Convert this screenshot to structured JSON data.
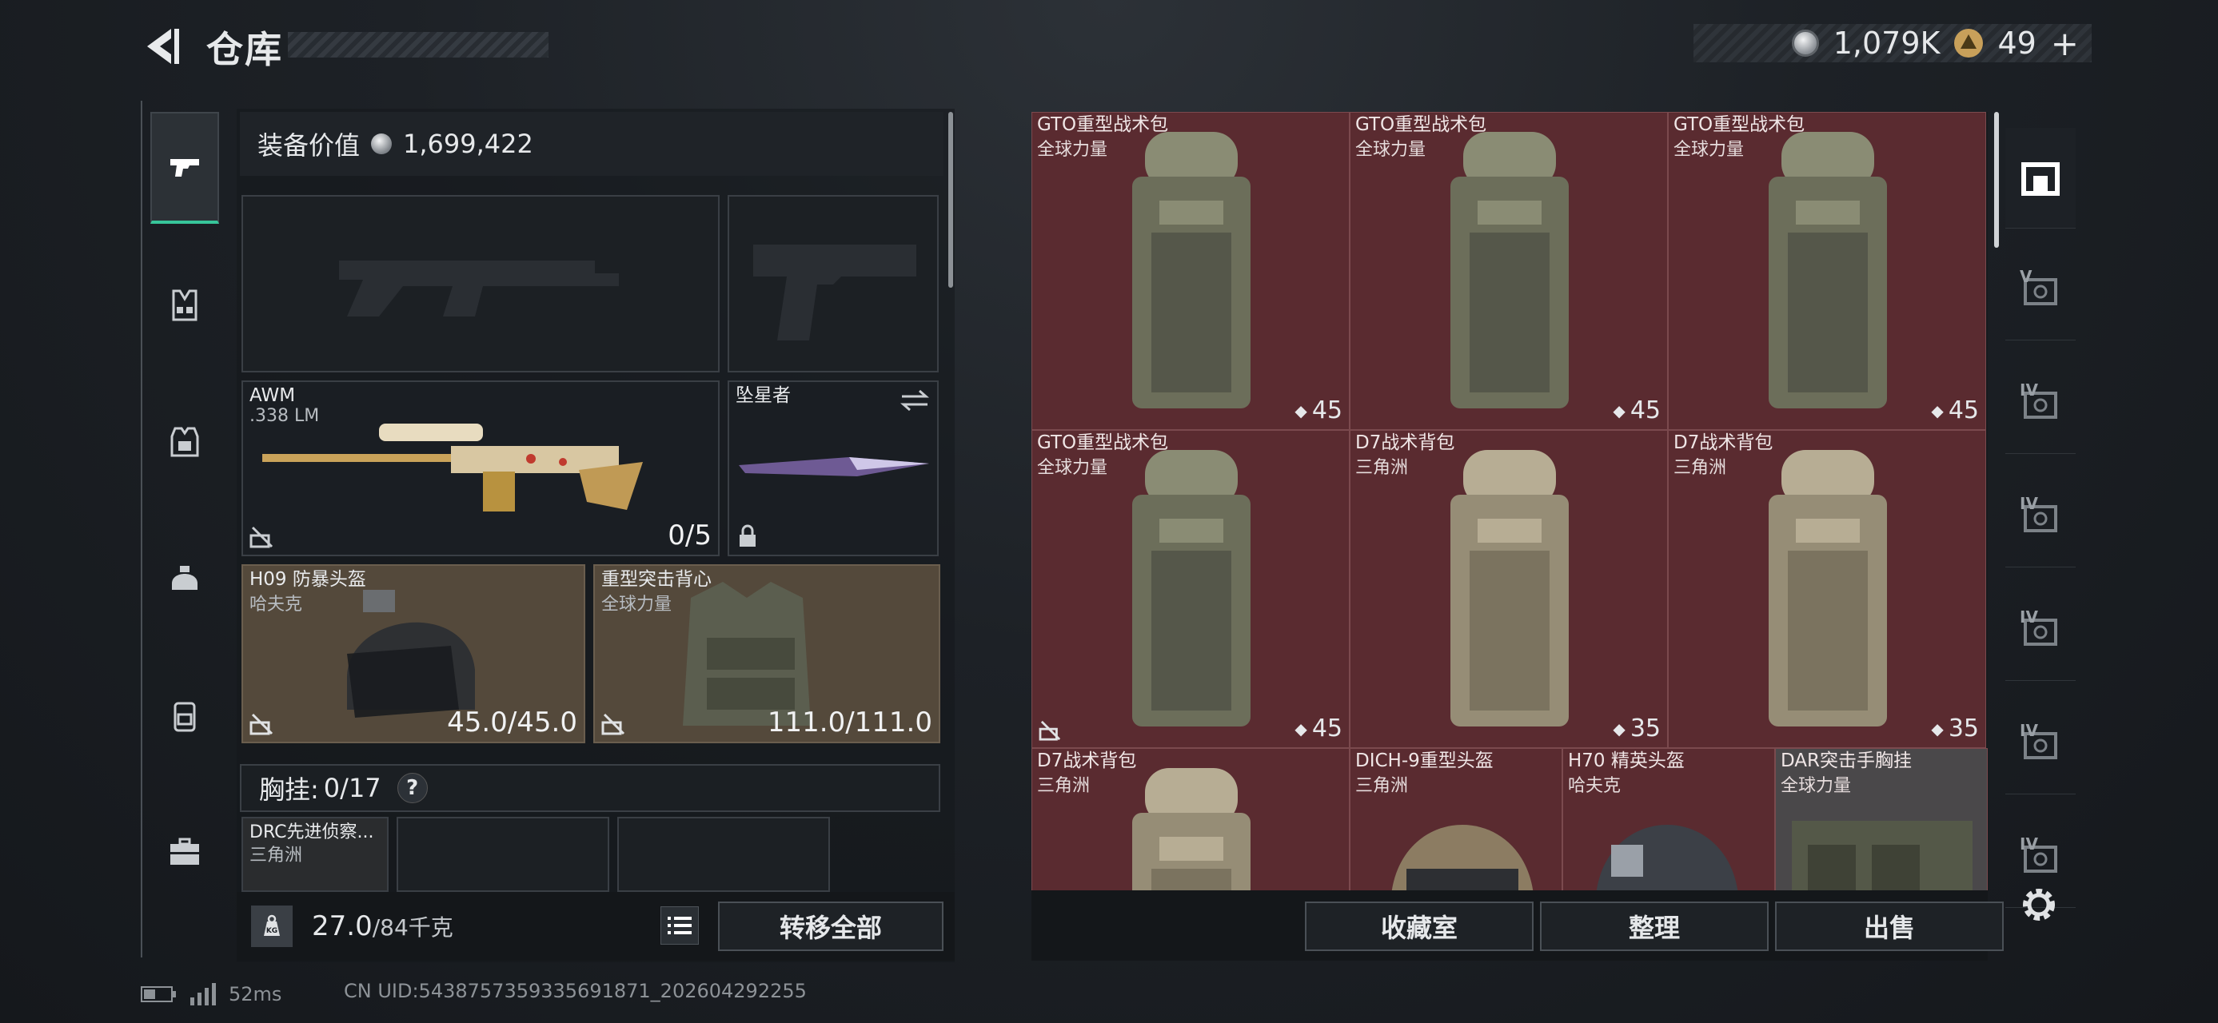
{
  "header": {
    "title": "仓库",
    "silver_amount": "1,079K",
    "gold_amount": "49",
    "gold_plus": "+"
  },
  "equipment": {
    "value_label": "装备价值",
    "value": "1,699,422",
    "primary_slot": {
      "name": "",
      "empty": true
    },
    "secondary_slot": {
      "name": "",
      "empty": true
    },
    "sniper": {
      "name": "AWM",
      "ammo_type": ".338 LM",
      "ammo_count": "0/5"
    },
    "melee": {
      "name": "坠星者"
    },
    "helmet": {
      "name": "H09 防暴头盔",
      "brand": "哈夫克",
      "durability": "45.0/45.0"
    },
    "armor": {
      "name": "重型突击背心",
      "brand": "全球力量",
      "durability": "111.0/111.0"
    },
    "chest_rig": {
      "label": "胸挂:",
      "count": "0/17",
      "help": "?"
    },
    "rig_items": [
      {
        "name": "DRC先进侦察...",
        "brand": "三角洲"
      }
    ],
    "weight": {
      "current": "27.0",
      "capacity": "/84千克",
      "kg_badge": "KG"
    },
    "transfer_all_label": "转移全部"
  },
  "storage": {
    "items": [
      {
        "name": "GTO重型战术包",
        "brand": "全球力量",
        "capacity": "45",
        "color": "olive"
      },
      {
        "name": "GTO重型战术包",
        "brand": "全球力量",
        "capacity": "45",
        "color": "olive"
      },
      {
        "name": "GTO重型战术包",
        "brand": "全球力量",
        "capacity": "45",
        "color": "olive"
      },
      {
        "name": "GTO重型战术包",
        "brand": "全球力量",
        "capacity": "45",
        "color": "olive"
      },
      {
        "name": "D7战术背包",
        "brand": "三角洲",
        "capacity": "35",
        "color": "tan"
      },
      {
        "name": "D7战术背包",
        "brand": "三角洲",
        "capacity": "35",
        "color": "tan"
      },
      {
        "name": "D7战术背包",
        "brand": "三角洲",
        "capacity": "",
        "color": "tan"
      },
      {
        "name": "DICH-9重型头盔",
        "brand": "三角洲",
        "capacity": "",
        "color": "helmet-camo"
      },
      {
        "name": "H70 精英头盔",
        "brand": "哈夫克",
        "capacity": "",
        "color": "helmet-black"
      },
      {
        "name": "DAR突击手胸挂",
        "brand": "全球力量",
        "capacity": "",
        "color": "rig"
      }
    ],
    "buttons": {
      "collection": "收藏室",
      "sort": "整理",
      "sell": "出售"
    }
  },
  "right_rail": {
    "tabs": [
      "V",
      "IV",
      "IV",
      "IV",
      "IV",
      "IV"
    ]
  },
  "status": {
    "ping": "52ms",
    "uid": "CN UID:5438757359335691871_202604292255"
  },
  "colors": {
    "accent": "#37c59a",
    "storage_cell": "#5a2b30",
    "equip_brown": "#54493b"
  }
}
